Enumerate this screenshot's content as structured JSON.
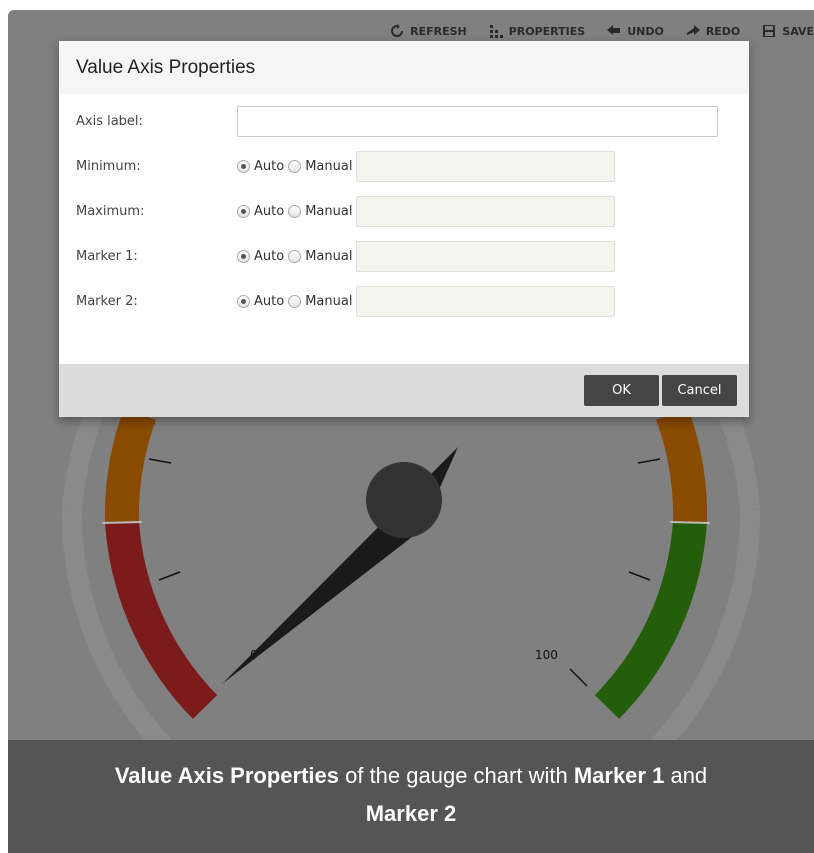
{
  "toolbar": {
    "refresh": "REFRESH",
    "properties": "PROPERTIES",
    "undo": "UNDO",
    "redo": "REDO",
    "save": "SAVE"
  },
  "gauge": {
    "min_label": "0",
    "max_label": "100",
    "value_fraction": 0.02,
    "colors": {
      "red": "#7c1b1b",
      "orange": "#8a4a00",
      "green": "#245e0b",
      "hub": "#333333",
      "needle": "#1a1a1a",
      "track": "#888888"
    }
  },
  "dialog": {
    "title": "Value Axis Properties",
    "axis_label": {
      "label": "Axis label:",
      "value": ""
    },
    "rows": [
      {
        "label": "Minimum:",
        "auto": "Auto",
        "manual": "Manual",
        "selected": "Auto",
        "value": ""
      },
      {
        "label": "Maximum:",
        "auto": "Auto",
        "manual": "Manual",
        "selected": "Auto",
        "value": ""
      },
      {
        "label": "Marker 1:",
        "auto": "Auto",
        "manual": "Manual",
        "selected": "Auto",
        "value": ""
      },
      {
        "label": "Marker 2:",
        "auto": "Auto",
        "manual": "Manual",
        "selected": "Auto",
        "value": ""
      }
    ],
    "ok": "OK",
    "cancel": "Cancel"
  },
  "caption": {
    "part1": "Value Axis Properties",
    "part2": " of the gauge chart with ",
    "part3": "Marker 1",
    "part4": " and ",
    "part5": "Marker 2"
  }
}
